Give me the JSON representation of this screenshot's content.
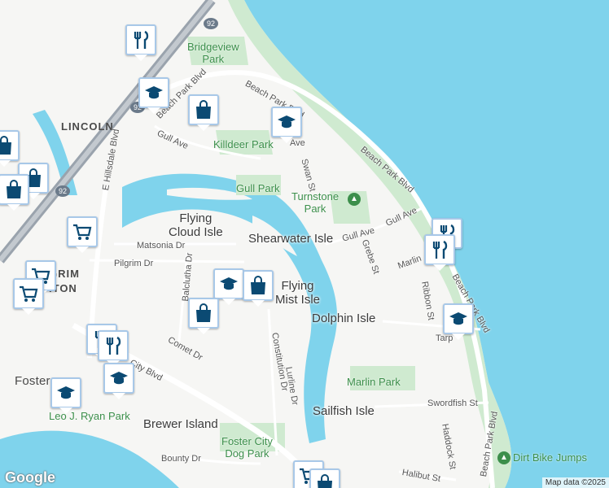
{
  "map": {
    "colors": {
      "water": "#7fd3ec",
      "land": "#f6f6f4",
      "park": "#cfead0",
      "road": "#ffffff",
      "highway": "#9aa3ad",
      "pin_border": "#a8c8e8",
      "pin_icon": "#0b4a73"
    },
    "places": [
      {
        "name": "bridgeview-park-label",
        "text": "Bridgeview\nPark",
        "type": "park"
      },
      {
        "name": "killdeer-park-label",
        "text": "Killdeer Park",
        "type": "park"
      },
      {
        "name": "gull-park-label",
        "text": "Gull Park",
        "type": "park"
      },
      {
        "name": "turnstone-park-label",
        "text": "Turnstone\nPark",
        "type": "park"
      },
      {
        "name": "marlin-park-label",
        "text": "Marlin Park",
        "type": "park"
      },
      {
        "name": "foster-city-dog-park-label",
        "text": "Foster City\nDog Park",
        "type": "park"
      },
      {
        "name": "leo-j-ryan-park-label",
        "text": "Leo J. Ryan Park",
        "type": "park"
      },
      {
        "name": "dirt-bike-jumps-label",
        "text": "Dirt Bike Jumps",
        "type": "park"
      },
      {
        "name": "flying-cloud-isle-label",
        "text": "Flying\nCloud Isle",
        "type": "isle"
      },
      {
        "name": "shearwater-isle-label",
        "text": "Shearwater Isle",
        "type": "isle"
      },
      {
        "name": "flying-mist-isle-label",
        "text": "Flying\nMist Isle",
        "type": "isle"
      },
      {
        "name": "dolphin-isle-label",
        "text": "Dolphin Isle",
        "type": "isle"
      },
      {
        "name": "sailfish-isle-label",
        "text": "Sailfish Isle",
        "type": "isle"
      },
      {
        "name": "brewer-island-label",
        "text": "Brewer Island",
        "type": "isle"
      },
      {
        "name": "lincoln-label",
        "text": "LINCOLN",
        "type": "city"
      },
      {
        "name": "pilgrim-triton-label",
        "text": "GRIM\nITON",
        "type": "city"
      },
      {
        "name": "foster-label",
        "text": "Foster",
        "type": "place"
      }
    ],
    "streets": [
      {
        "name": "beach-park-blvd-north",
        "text": "Beach Park Blvd"
      },
      {
        "name": "beach-park-blvd-west",
        "text": "Beach Park Blvd"
      },
      {
        "name": "beach-park-blvd-east",
        "text": "Beach Park Blvd"
      },
      {
        "name": "beach-park-blvd-se",
        "text": "Beach Park Blvd"
      },
      {
        "name": "beach-park-blvd-south",
        "text": "Beach Park Blvd"
      },
      {
        "name": "gull-ave-west",
        "text": "Gull Ave"
      },
      {
        "name": "gull-ave-mid",
        "text": "Gull Ave"
      },
      {
        "name": "gull-ave-east",
        "text": "Gull Ave"
      },
      {
        "name": "e-hillsdale-blvd",
        "text": "E Hillsdale Blvd"
      },
      {
        "name": "matsonia-dr",
        "text": "Matsonia Dr"
      },
      {
        "name": "pilgrim-dr",
        "text": "Pilgrim Dr"
      },
      {
        "name": "balclutha-dr",
        "text": "Balclutha Dr"
      },
      {
        "name": "comet-dr",
        "text": "Comet Dr"
      },
      {
        "name": "city-blvd",
        "text": "City Blvd"
      },
      {
        "name": "constitution-dr",
        "text": "Constitution Dr"
      },
      {
        "name": "lurline-dr",
        "text": "Lurline Dr"
      },
      {
        "name": "swan-st",
        "text": "Swan St"
      },
      {
        "name": "grebe-st",
        "text": "Grebe St"
      },
      {
        "name": "marlin-st",
        "text": "Marlin"
      },
      {
        "name": "ribbon-st",
        "text": "Ribbon St"
      },
      {
        "name": "tarpon-st",
        "text": "Tarp"
      },
      {
        "name": "swordfish-st",
        "text": "Swordfish St"
      },
      {
        "name": "haddock-st",
        "text": "Haddock St"
      },
      {
        "name": "halibut-st",
        "text": "Halibut St"
      },
      {
        "name": "bounty-dr",
        "text": "Bounty Dr"
      },
      {
        "name": "ave-fragment",
        "text": "Ave"
      }
    ],
    "highway_shields": [
      "92",
      "92",
      "92"
    ],
    "pins": [
      {
        "name": "restaurant-pin",
        "icon": "restaurant-icon"
      },
      {
        "name": "school-pin",
        "icon": "school-icon"
      },
      {
        "name": "shopping-pin",
        "icon": "shopping-bag-icon"
      },
      {
        "name": "school-pin",
        "icon": "school-icon"
      },
      {
        "name": "shopping-pin",
        "icon": "shopping-bag-icon"
      },
      {
        "name": "shopping-pin",
        "icon": "shopping-bag-icon"
      },
      {
        "name": "shopping-pin",
        "icon": "shopping-bag-icon"
      },
      {
        "name": "grocery-pin",
        "icon": "shopping-cart-icon"
      },
      {
        "name": "grocery-pin",
        "icon": "shopping-cart-icon"
      },
      {
        "name": "grocery-pin",
        "icon": "shopping-cart-icon"
      },
      {
        "name": "school-pin",
        "icon": "school-icon"
      },
      {
        "name": "shopping-pin",
        "icon": "shopping-bag-icon"
      },
      {
        "name": "shopping-pin",
        "icon": "shopping-bag-icon"
      },
      {
        "name": "restaurant-pin",
        "icon": "restaurant-icon"
      },
      {
        "name": "restaurant-pin",
        "icon": "restaurant-icon"
      },
      {
        "name": "school-pin",
        "icon": "school-icon"
      },
      {
        "name": "school-pin",
        "icon": "school-icon"
      },
      {
        "name": "restaurant-pin",
        "icon": "restaurant-icon"
      },
      {
        "name": "restaurant-pin",
        "icon": "restaurant-icon"
      },
      {
        "name": "school-pin",
        "icon": "school-icon"
      },
      {
        "name": "grocery-pin",
        "icon": "shopping-cart-icon"
      },
      {
        "name": "shopping-pin",
        "icon": "shopping-bag-icon"
      }
    ],
    "attribution": "Map data ©2025",
    "logo": "Google"
  }
}
